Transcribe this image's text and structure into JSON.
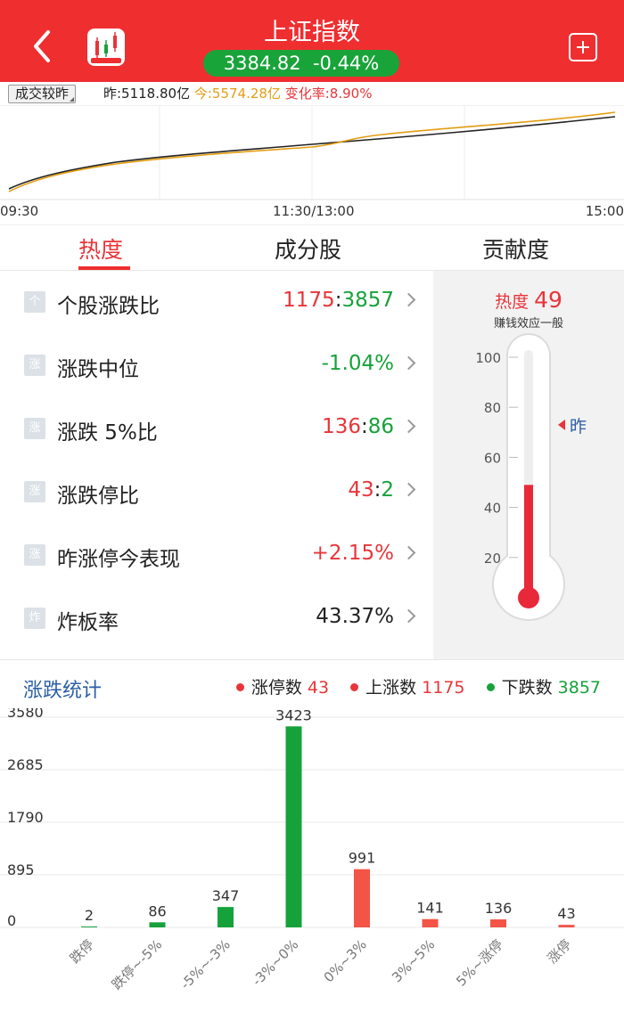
{
  "header": {
    "title": "上证指数",
    "price": "3384.82",
    "change": "-0.44%",
    "icon": "chevron-left-icon",
    "app_icon": "candlestick-app-icon",
    "add_icon": "plus-square-icon"
  },
  "volume": {
    "button": "成交较昨",
    "yesterday": "昨:5118.80亿",
    "today": "今:5574.28亿",
    "change_rate": "变化率:8.90%"
  },
  "intraday": {
    "times": [
      "09:30",
      "11:30/13:00",
      "15:00"
    ],
    "colors": {
      "today": "#e39d12",
      "yesterday": "#222222"
    }
  },
  "tabs": [
    {
      "label": "热度",
      "active": true
    },
    {
      "label": "成分股",
      "active": false
    },
    {
      "label": "贡献度",
      "active": false
    }
  ],
  "metrics": [
    {
      "icon": "个",
      "label": "个股涨跌比",
      "value_a": "1175",
      "sep": ":",
      "value_b": "3857"
    },
    {
      "icon": "涨",
      "label": "涨跌中位",
      "value": "-1.04%",
      "color": "green"
    },
    {
      "icon": "涨",
      "label": "涨跌 5%比",
      "value_a": "136",
      "sep": ":",
      "value_b": "86"
    },
    {
      "icon": "涨",
      "label": "涨跌停比",
      "value_a": "43",
      "sep": ":",
      "value_b": "2"
    },
    {
      "icon": "涨",
      "label": "昨涨停今表现",
      "value": "+2.15%",
      "color": "red"
    },
    {
      "icon": "炸",
      "label": "炸板率",
      "value": "43.37%",
      "color": "dark"
    }
  ],
  "thermometer": {
    "heat_label": "热度",
    "heat_value": "49",
    "subtitle": "赚钱效应一般",
    "scale": [
      "100",
      "80",
      "60",
      "40",
      "20"
    ],
    "level": 49,
    "yesterday_label": "昨",
    "yesterday_level": 73
  },
  "stats": {
    "title": "涨跌统计",
    "legend": [
      {
        "label": "涨停数",
        "value": "43",
        "color": "#e8353a"
      },
      {
        "label": "上涨数",
        "value": "1175",
        "color": "#e8353a"
      },
      {
        "label": "下跌数",
        "value": "3857",
        "color": "#16a23a"
      }
    ]
  },
  "chart_data": {
    "type": "bar",
    "categories": [
      "跌停",
      "跌停~-5%",
      "-5%~-3%",
      "-3%~0%",
      "0%~3%",
      "3%~5%",
      "5%~涨停",
      "涨停"
    ],
    "values": [
      2,
      86,
      347,
      3423,
      991,
      141,
      136,
      43
    ],
    "colors": [
      "#16a23a",
      "#16a23a",
      "#16a23a",
      "#16a23a",
      "#f35445",
      "#f35445",
      "#f35445",
      "#f35445"
    ],
    "y_ticks": [
      "3580",
      "2685",
      "1790",
      "895",
      "0"
    ],
    "ylim": [
      0,
      3580
    ]
  }
}
